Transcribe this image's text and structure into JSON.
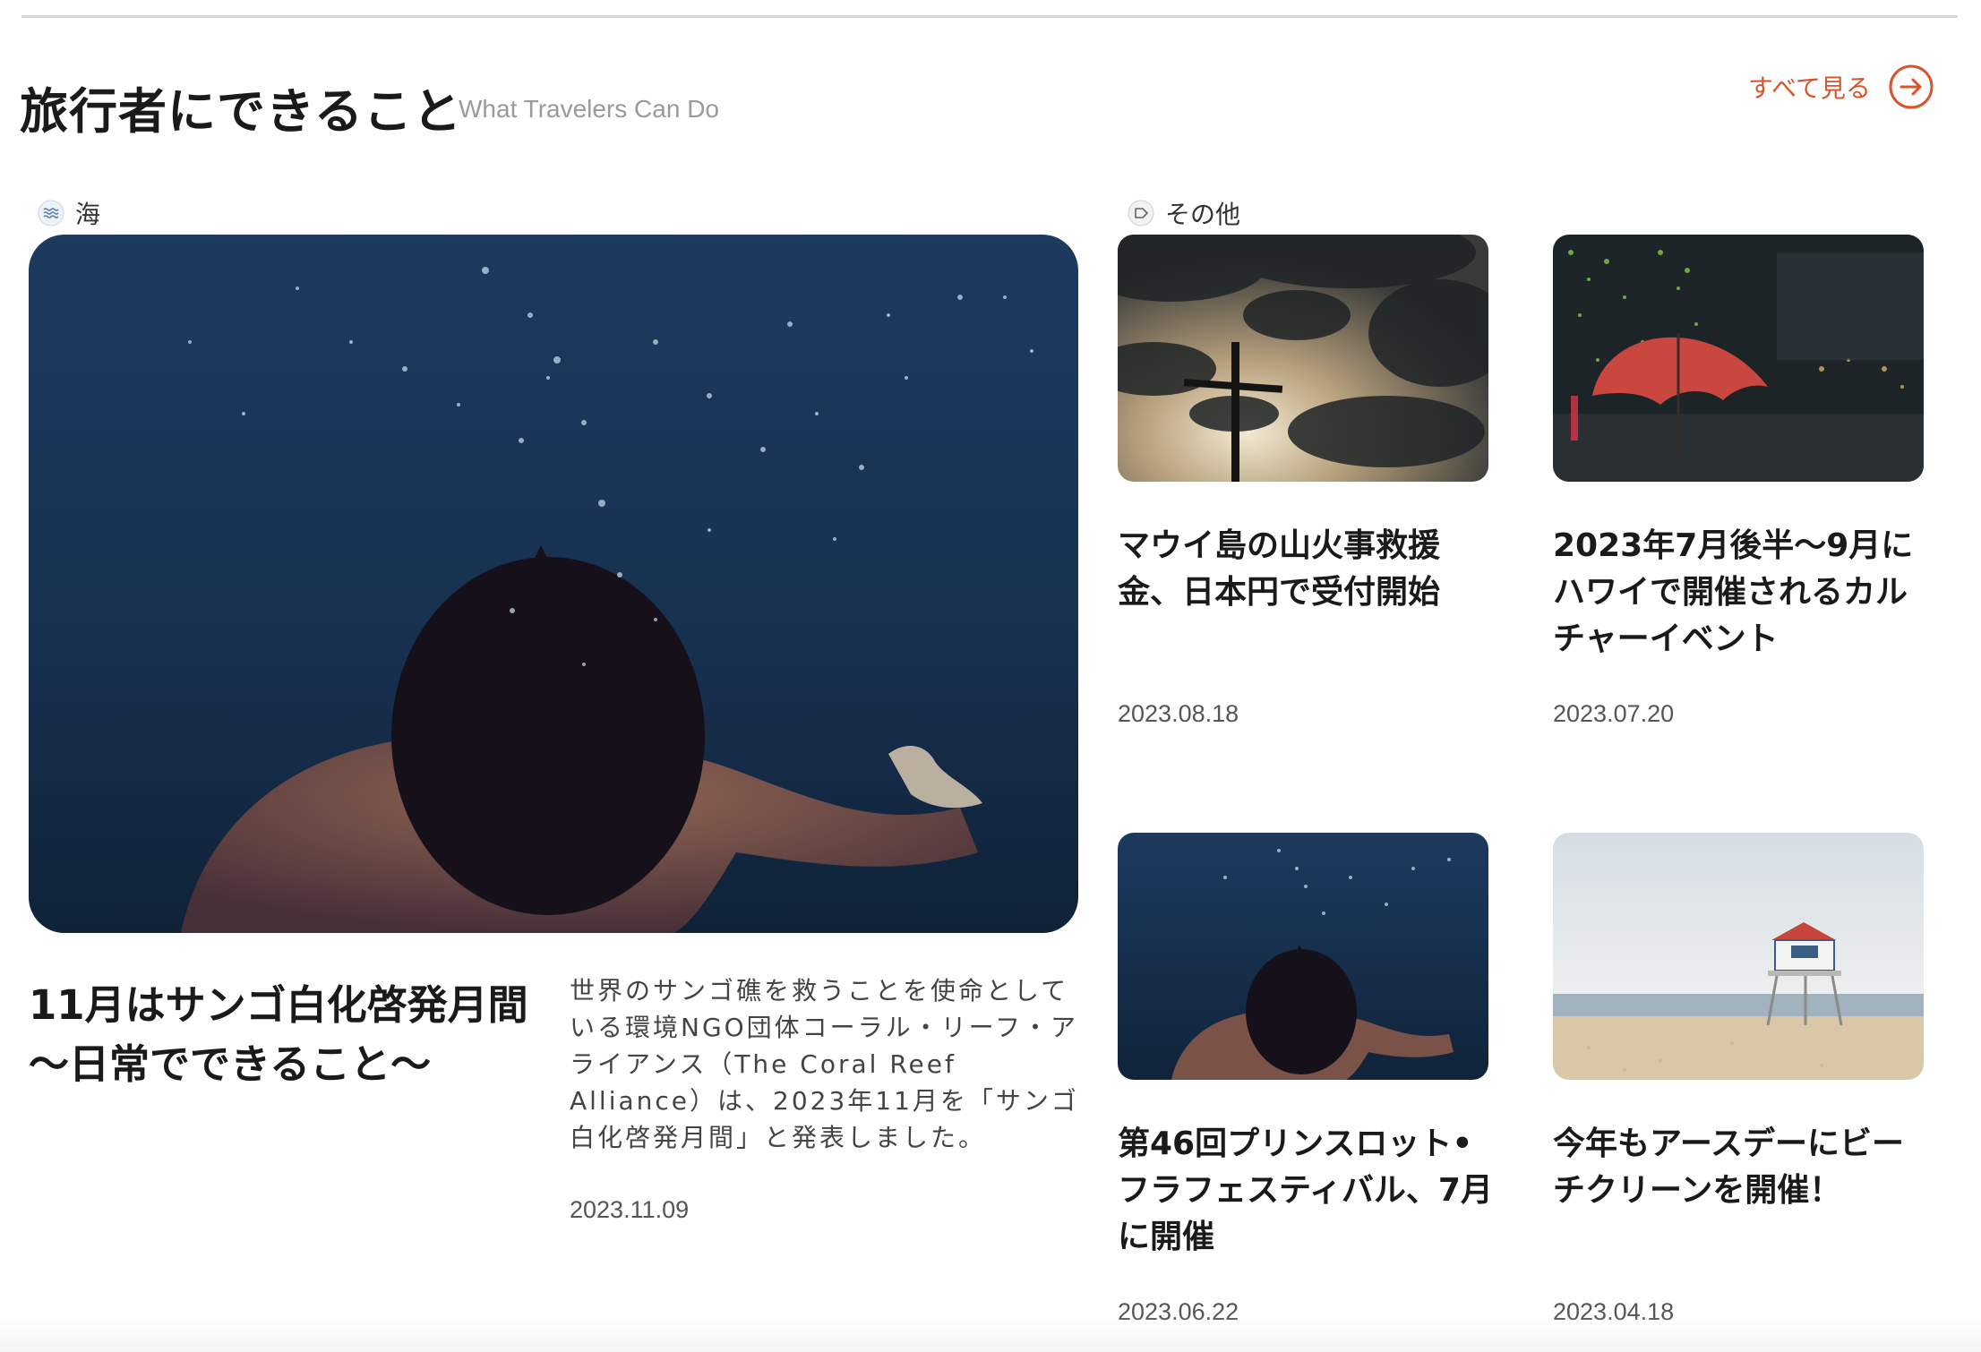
{
  "header": {
    "title": "旅行者にできること",
    "subtitle": "What Travelers Can Do",
    "see_all_label": "すべて見る",
    "see_all_icon": "arrow-right-circle-icon",
    "accent_color": "#d9542b"
  },
  "categories": {
    "sea": {
      "label": "海",
      "icon": "waves-icon"
    },
    "other": {
      "label": "その他",
      "icon": "tag-icon"
    }
  },
  "featured": {
    "title": "11月はサンゴ白化啓発月間　～日常でできること～",
    "description": "世界のサンゴ礁を救うことを使命としている環境NGO団体コーラル・リーフ・アライアンス（The Coral Reef Alliance）は、2023年11月を「サンゴ白化啓発月間」と発表しました。",
    "date": "2023.11.09",
    "image": "underwater-swimmer-photo"
  },
  "articles": [
    {
      "title": "マウイ島の山火事救援金、日本円で受付開始",
      "date": "2023.08.18",
      "image": "cross-and-clouds-photo"
    },
    {
      "title": "2023年7月後半～9月にハワイで開催されるカルチャーイベント",
      "date": "2023.07.20",
      "image": "red-umbrella-night-photo"
    },
    {
      "title": "第46回プリンスロット•フラフェスティバル、7月に開催",
      "date": "2023.06.22",
      "image": "underwater-swimmer-photo"
    },
    {
      "title": "今年もアースデーにビーチクリーンを開催！",
      "date": "2023.04.18",
      "image": "lifeguard-tower-beach-photo"
    }
  ]
}
